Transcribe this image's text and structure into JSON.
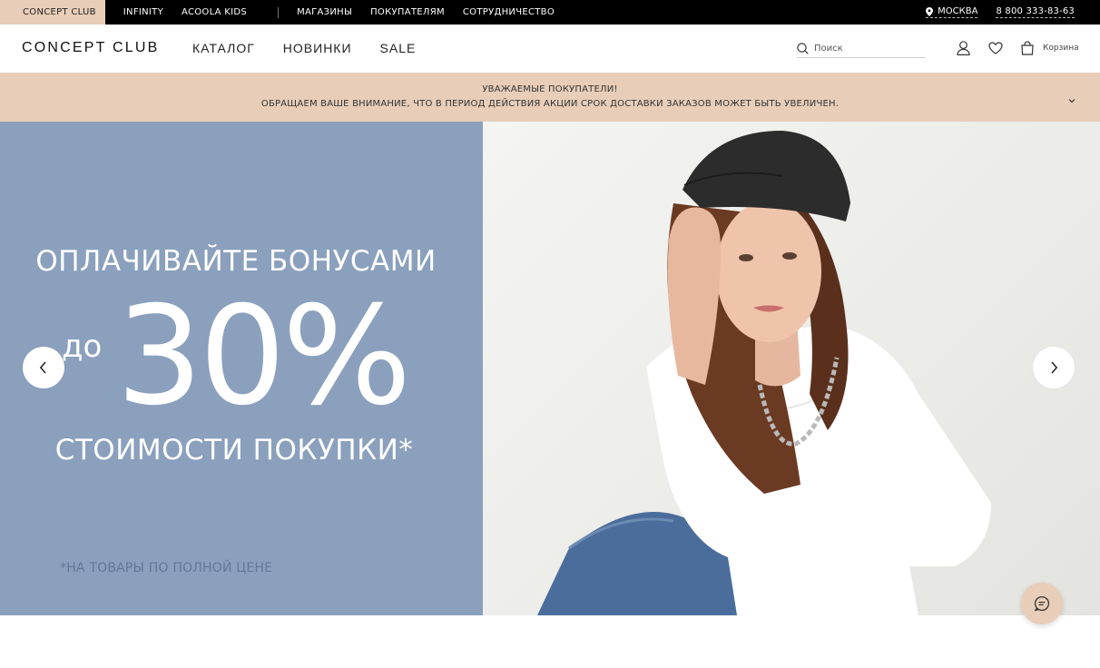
{
  "topbar": {
    "brand_tabs": [
      "CONCEPT CLUB",
      "INFINITY",
      "ACOOLA KIDS"
    ],
    "links": [
      "МАГАЗИНЫ",
      "ПОКУПАТЕЛЯМ",
      "СОТРУДНИЧЕСТВО"
    ],
    "city": "МОСКВА",
    "phone": "8 800 333-83-63"
  },
  "header": {
    "logo": "CONCEPT CLUB",
    "nav": [
      "КАТАЛОГ",
      "НОВИНКИ",
      "SALE"
    ],
    "search_placeholder": "Поиск",
    "cart_label": "Корзина"
  },
  "notice": {
    "line1": "УВАЖАЕМЫЕ ПОКУПАТЕЛИ!",
    "line2": "ОБРАЩАЕМ ВАШЕ ВНИМАНИЕ, ЧТО В ПЕРИОД ДЕЙСТВИЯ АКЦИИ СРОК ДОСТАВКИ ЗАКАЗОВ МОЖЕТ БЫТЬ УВЕЛИЧЕН."
  },
  "hero": {
    "line1": "ОПЛАЧИВАЙТЕ БОНУСАМИ",
    "prefix": "до",
    "big": "30%",
    "line3": "СТОИМОСТИ ПОКУПКИ*",
    "footnote": "*НА ТОВАРЫ ПО ПОЛНОЙ ЦЕНЕ"
  },
  "colors": {
    "accent": "#e8cdb8",
    "hero_left_bg": "#8aa0bd",
    "topbar_bg": "#000000"
  },
  "icons": [
    "location-pin-icon",
    "search-icon",
    "user-icon",
    "heart-icon",
    "bag-icon",
    "chevron-down-icon",
    "chevron-left-icon",
    "chevron-right-icon",
    "chat-icon"
  ]
}
